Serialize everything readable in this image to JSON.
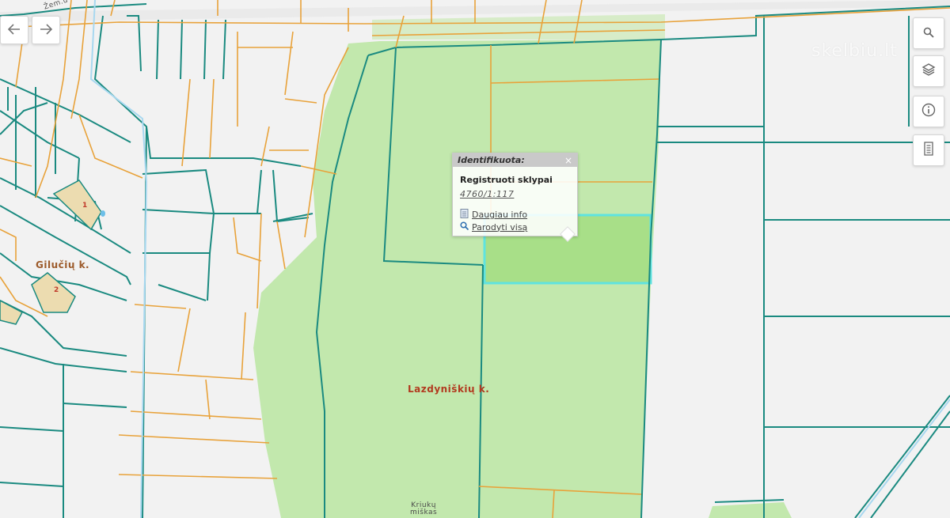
{
  "map": {
    "labels": {
      "village_lazdyniskiu": "Lazdyniškių k.",
      "village_gilucių": "Gilučių k.",
      "forest_name_line1": "Kriukų",
      "forest_name_line2": "miškas",
      "road_name": "Žem.ū",
      "house_number_1": "1",
      "house_number_2": "2"
    },
    "colors": {
      "background": "#f2f2f2",
      "forest_fill": "#c2e8ad",
      "parcel_outline_teal": "#1a8a80",
      "parcel_outline_orange": "#e8a23a",
      "highlight_fill": "#a8df88",
      "highlight_outline": "#5fe3e0",
      "village_label": "#b23a1f"
    }
  },
  "navigation": {
    "back_icon": "arrow-left-icon",
    "forward_icon": "arrow-right-icon"
  },
  "toolbar": {
    "search_icon": "search-icon",
    "layers_icon": "layers-icon",
    "info_icon": "info-icon",
    "legend_icon": "document-icon"
  },
  "watermark": {
    "text": "skelbiu.lt"
  },
  "popup": {
    "title": "Identifikuota:",
    "close": "×",
    "layer_name": "Registruoti sklypai",
    "parcel_id": "4760/1:117",
    "link_more_info": "Daugiau info",
    "link_show_all": "Parodyti visą"
  }
}
